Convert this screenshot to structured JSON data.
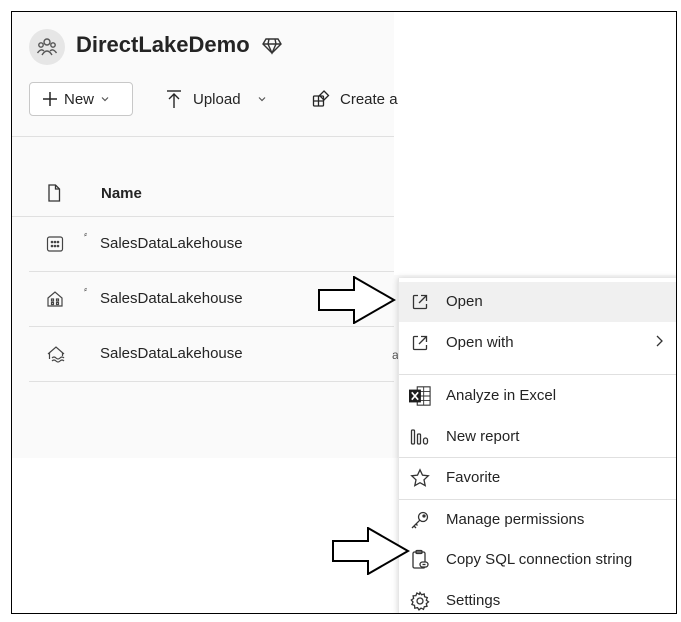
{
  "workspace": {
    "title": "DirectLakeDemo",
    "icon": "workspace-people-icon",
    "badge_icon": "diamond-premium-icon"
  },
  "toolbar": {
    "new_label": "New",
    "upload_label": "Upload",
    "create_label": "Create a"
  },
  "table": {
    "name_header": "Name",
    "rows": [
      {
        "name": "SalesDataLakehouse",
        "icon": "sql-endpoint-icon"
      },
      {
        "name": "SalesDataLakehouse",
        "icon": "semantic-model-icon"
      },
      {
        "name": "SalesDataLakehouse",
        "icon": "lakehouse-icon"
      }
    ],
    "row3_trailing": "a"
  },
  "context_menu": {
    "items": [
      {
        "label": "Open",
        "icon": "open-external-icon"
      },
      {
        "label": "Open with",
        "icon": "open-external-icon"
      },
      {
        "label": "Analyze in Excel",
        "icon": "excel-icon"
      },
      {
        "label": "New report",
        "icon": "report-bars-icon"
      },
      {
        "label": "Favorite",
        "icon": "star-icon"
      },
      {
        "label": "Manage permissions",
        "icon": "key-icon"
      },
      {
        "label": "Copy SQL connection string",
        "icon": "clipboard-link-icon"
      },
      {
        "label": "Settings",
        "icon": "gear-icon"
      }
    ]
  },
  "colors": {
    "accent": "#242424",
    "excel_green": "#1d6f42",
    "border": "#c8c8c8"
  }
}
